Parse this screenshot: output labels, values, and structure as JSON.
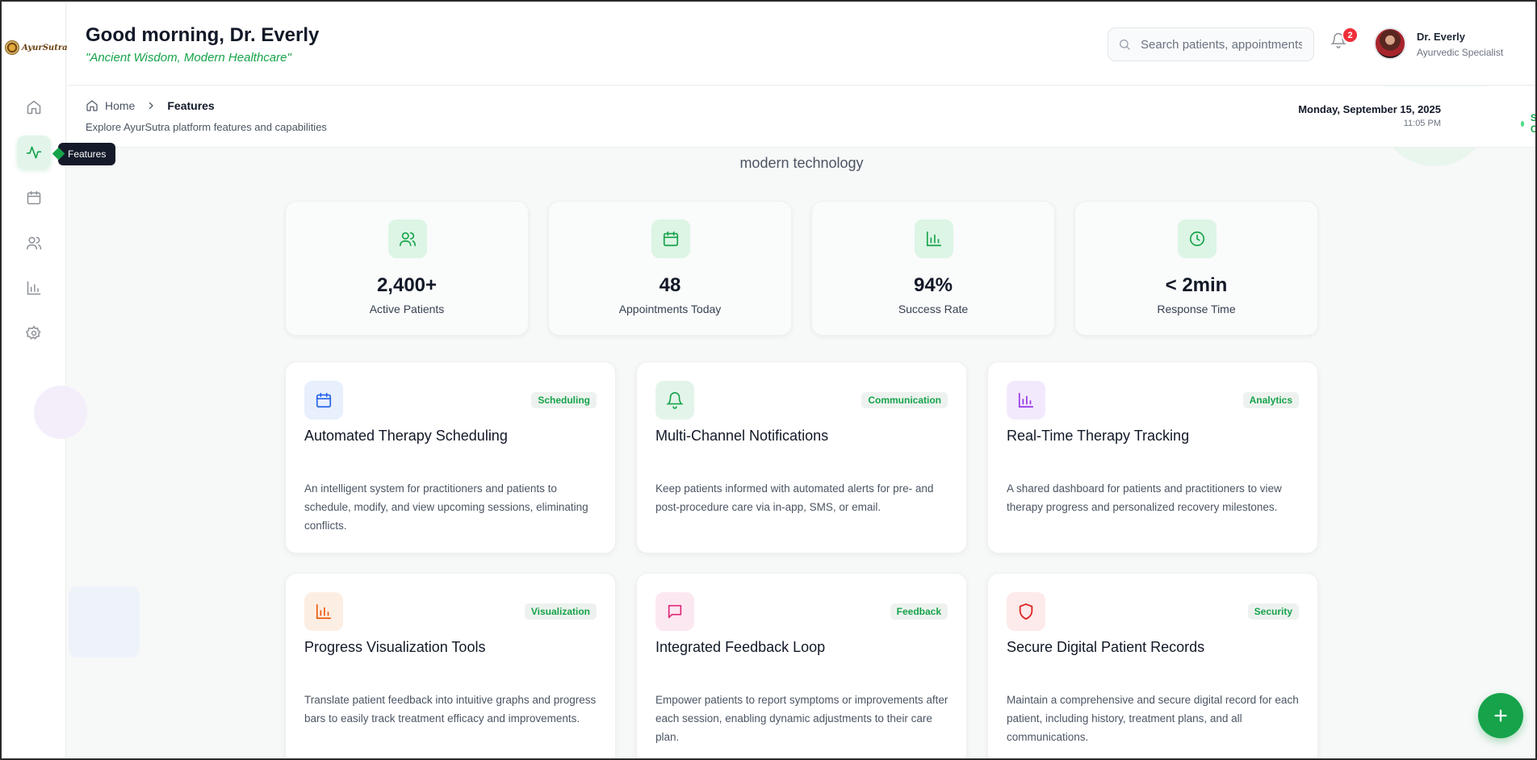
{
  "app": {
    "logo_text": "AyurSutra"
  },
  "sidebar": {
    "items": [
      {
        "label": "Home",
        "icon": "home-icon",
        "active": false
      },
      {
        "label": "Features",
        "icon": "activity-icon",
        "active": true
      },
      {
        "label": "Calendar",
        "icon": "calendar-icon",
        "active": false
      },
      {
        "label": "Patients",
        "icon": "users-icon",
        "active": false
      },
      {
        "label": "Analytics",
        "icon": "bar-chart-icon",
        "active": false
      },
      {
        "label": "Settings",
        "icon": "gear-icon",
        "active": false
      }
    ],
    "tooltip": "Features"
  },
  "header": {
    "greeting": "Good morning, Dr. Everly",
    "tagline": "\"Ancient Wisdom, Modern Healthcare\"",
    "search_placeholder": "Search patients, appointments...",
    "notification_count": "2",
    "user_name": "Dr. Everly",
    "user_role": "Ayurvedic Specialist"
  },
  "subheader": {
    "breadcrumb_home": "Home",
    "breadcrumb_current": "Features",
    "subtitle": "Explore AyurSutra platform features and capabilities",
    "date": "Monday, September 15, 2025",
    "time": "11:05 PM",
    "status": "System Online"
  },
  "hero": {
    "line": "modern technology"
  },
  "stats": [
    {
      "value": "2,400+",
      "label": "Active Patients",
      "icon": "users-icon"
    },
    {
      "value": "48",
      "label": "Appointments Today",
      "icon": "calendar-icon"
    },
    {
      "value": "94%",
      "label": "Success Rate",
      "icon": "bar-chart-icon"
    },
    {
      "value": "< 2min",
      "label": "Response Time",
      "icon": "clock-icon"
    }
  ],
  "features": [
    {
      "title": "Automated Therapy Scheduling",
      "tag": "Scheduling",
      "icon": "calendar-icon",
      "icon_color": "#2563eb",
      "icon_bg": "#e8effd",
      "description": "An intelligent system for practitioners and patients to schedule, modify, and view upcoming sessions, eliminating conflicts."
    },
    {
      "title": "Multi-Channel Notifications",
      "tag": "Communication",
      "icon": "bell-icon",
      "icon_color": "#16a34a",
      "icon_bg": "#e3f5ea",
      "description": "Keep patients informed with automated alerts for pre- and post-procedure care via in-app, SMS, or email."
    },
    {
      "title": "Real-Time Therapy Tracking",
      "tag": "Analytics",
      "icon": "bar-chart-icon",
      "icon_color": "#9333ea",
      "icon_bg": "#f3e9fc",
      "description": "A shared dashboard for patients and practitioners to view therapy progress and personalized recovery milestones."
    },
    {
      "title": "Progress Visualization Tools",
      "tag": "Visualization",
      "icon": "bar-chart-icon",
      "icon_color": "#ea580c",
      "icon_bg": "#fdeee3",
      "description": "Translate patient feedback into intuitive graphs and progress bars to easily track treatment efficacy and improvements."
    },
    {
      "title": "Integrated Feedback Loop",
      "tag": "Feedback",
      "icon": "message-icon",
      "icon_color": "#db2777",
      "icon_bg": "#fce8f1",
      "description": "Empower patients to report symptoms or improvements after each session, enabling dynamic adjustments to their care plan."
    },
    {
      "title": "Secure Digital Patient Records",
      "tag": "Security",
      "icon": "shield-icon",
      "icon_color": "#dc2626",
      "icon_bg": "#fdeaea",
      "description": "Maintain a comprehensive and secure digital record for each patient, including history, treatment plans, and all communications."
    }
  ]
}
